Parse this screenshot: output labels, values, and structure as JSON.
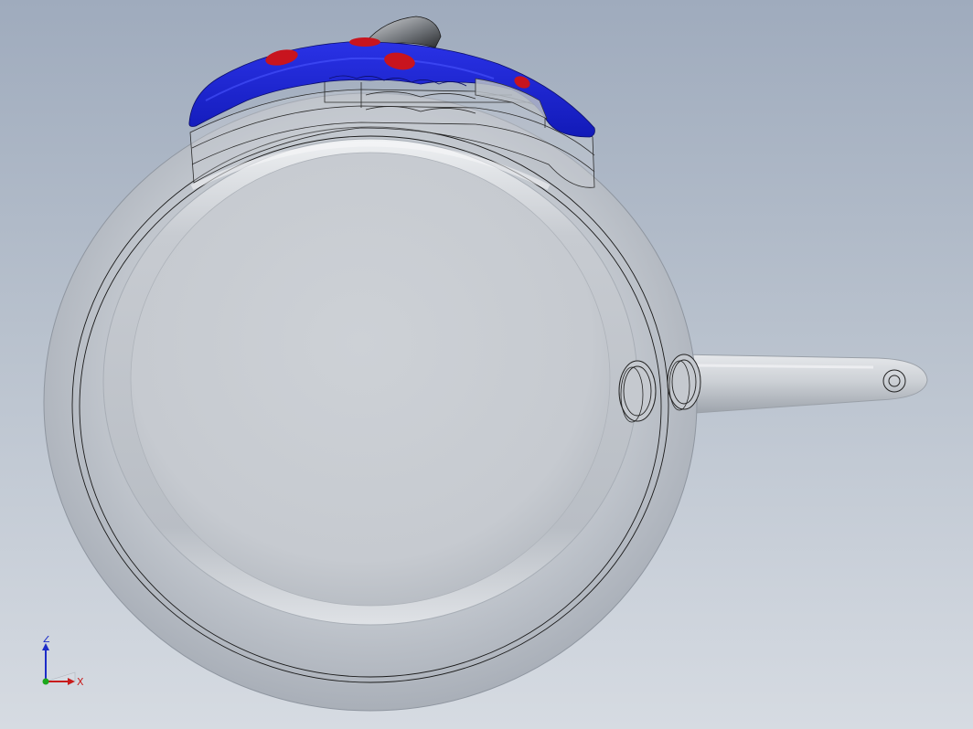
{
  "viewport": {
    "background_top": "#9fabbd",
    "background_bottom": "#d6dbe2"
  },
  "model": {
    "body_color": "#bfc5cc",
    "edge_color": "#1a1a1a",
    "handle_color": "#c9cdd2",
    "lid_handle_color": "#1f26d6",
    "lid_handle_dots_color": "#c8141e"
  },
  "triad": {
    "z_label": "Z",
    "x_label": "X",
    "z_color": "#1c2cc8",
    "x_color": "#c81c1c",
    "origin_color": "#1ca81c"
  }
}
